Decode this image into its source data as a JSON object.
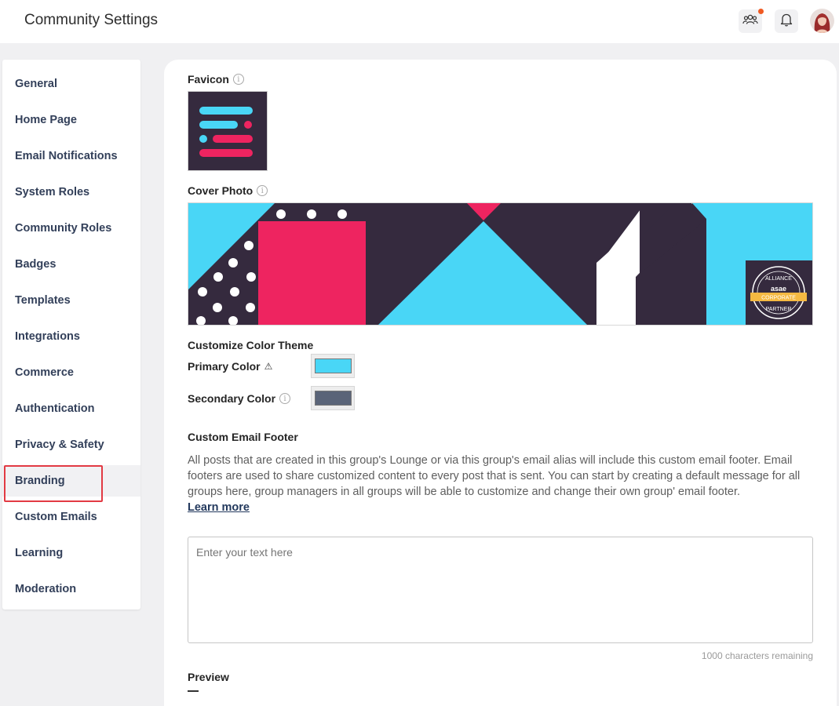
{
  "header": {
    "title": "Community Settings",
    "icons": [
      "members-icon",
      "bell-icon"
    ],
    "notification_color": "#f05a22"
  },
  "sidebar": {
    "items": [
      {
        "label": "General"
      },
      {
        "label": "Home Page"
      },
      {
        "label": "Email Notifications"
      },
      {
        "label": "System Roles"
      },
      {
        "label": "Community Roles"
      },
      {
        "label": "Badges"
      },
      {
        "label": "Templates"
      },
      {
        "label": "Integrations"
      },
      {
        "label": "Commerce"
      },
      {
        "label": "Authentication"
      },
      {
        "label": "Privacy & Safety"
      },
      {
        "label": "Branding",
        "active": true
      },
      {
        "label": "Custom Emails"
      },
      {
        "label": "Learning"
      },
      {
        "label": "Moderation"
      }
    ]
  },
  "main": {
    "favicon_label": "Favicon",
    "cover_label": "Cover Photo",
    "cover_badge": {
      "top": "ALLIANCE",
      "brand": "asae",
      "ribbon": "CORPORATE",
      "bottom": "PARTNER"
    },
    "color_theme_title": "Customize Color Theme",
    "primary_label": "Primary Color",
    "primary_color": "#49d6f6",
    "secondary_label": "Secondary Color",
    "secondary_color": "#5a6478",
    "footer_title": "Custom Email Footer",
    "footer_description": "All posts that are created in this group's Lounge or via this group's email alias will include this custom email footer. Email footers are used to share customized content to every post that is sent. You can start by creating a default message for all groups here, group managers in all groups will be able to customize and change their own group' email footer.",
    "learn_more": "Learn more",
    "textarea_placeholder": "Enter your text here",
    "char_counter": "1000 characters remaining",
    "preview_label": "Preview"
  },
  "colors": {
    "brand_dark": "#352a3e",
    "brand_cyan": "#49d6f6",
    "brand_pink": "#ee2460",
    "highlight": "#e23a43"
  }
}
